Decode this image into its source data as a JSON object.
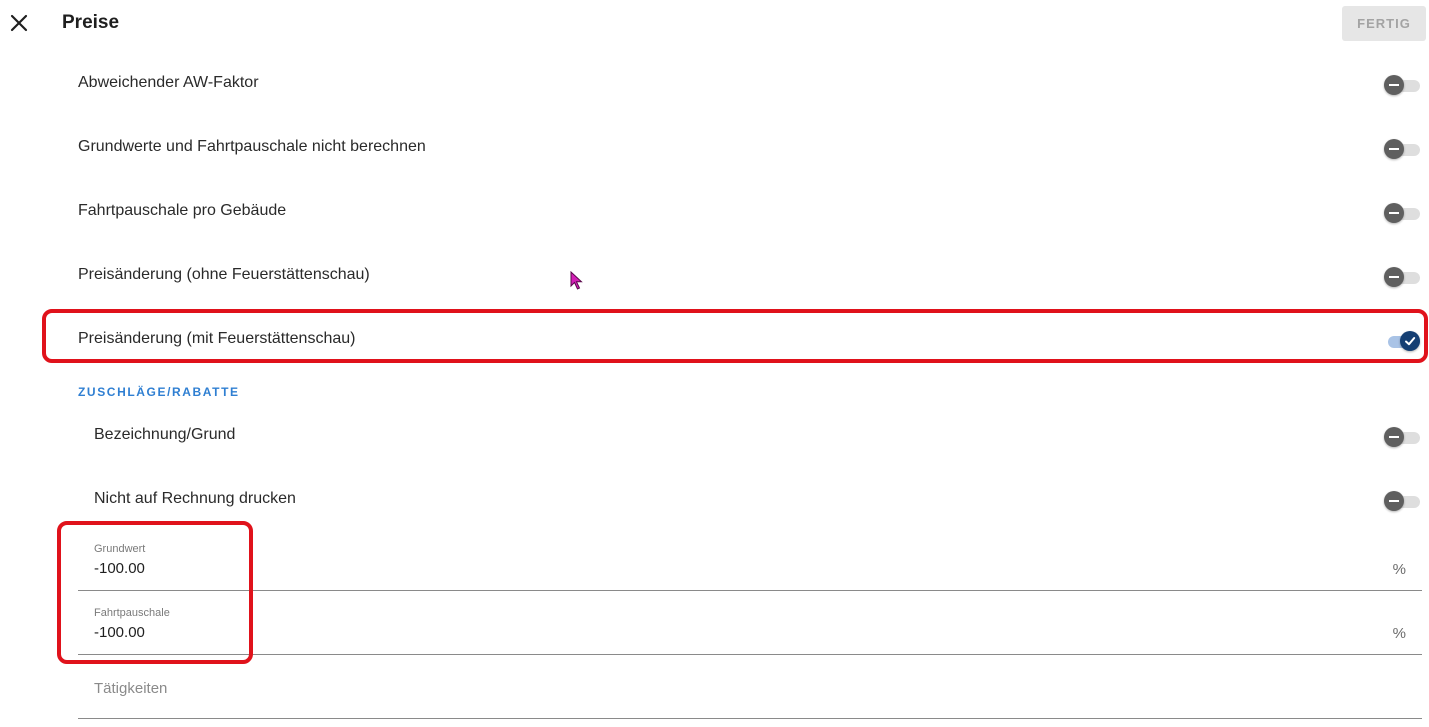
{
  "header": {
    "title": "Preise",
    "done_label": "FERTIG"
  },
  "toggles": [
    {
      "label": "Abweichender AW-Faktor",
      "checked": false
    },
    {
      "label": "Grundwerte und Fahrtpauschale nicht berechnen",
      "checked": false
    },
    {
      "label": "Fahrtpauschale pro Gebäude",
      "checked": false
    },
    {
      "label": "Preisänderung (ohne Feuerstättenschau)",
      "checked": false
    },
    {
      "label": "Preisänderung (mit Feuerstättenschau)",
      "checked": true
    }
  ],
  "section": {
    "title": "ZUSCHLÄGE/RABATTE",
    "toggles": [
      {
        "label": "Bezeichnung/Grund",
        "checked": false
      },
      {
        "label": "Nicht auf Rechnung drucken",
        "checked": false
      }
    ],
    "fields": [
      {
        "label": "Grundwert",
        "value": "-100.00",
        "suffix": "%"
      },
      {
        "label": "Fahrtpauschale",
        "value": "-100.00",
        "suffix": "%"
      }
    ],
    "activities_placeholder": "Tätigkeiten"
  },
  "icons": {
    "close": "close-icon",
    "toggle_off": "minus-icon",
    "toggle_on": "check-icon",
    "cursor": "mouse-pointer-icon"
  },
  "colors": {
    "accent": "#2f7fd2",
    "toggle_on": "#153f73",
    "toggle_off": "#5f5f5f",
    "highlight": "#e0121b"
  }
}
